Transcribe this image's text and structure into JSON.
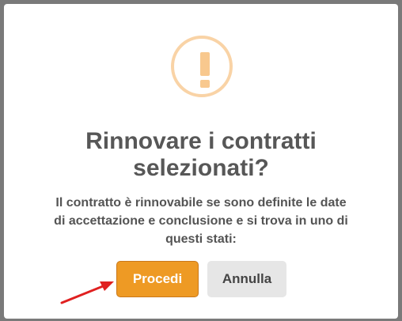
{
  "dialog": {
    "icon": "warning-exclamation-icon",
    "icon_glyph": "!",
    "title_line1": "Rinnovare i contratti",
    "title_line2": "selezionati?",
    "message_line1": "Il contratto è rinnovabile se sono definite le date",
    "message_line2": "di accettazione e conclusione e si trova in uno di",
    "message_line3": "questi stati:",
    "confirm_label": "Procedi",
    "cancel_label": "Annulla"
  },
  "colors": {
    "primary_button": "#ee9a24",
    "secondary_button": "#e6e6e6",
    "icon_accent": "#f8c88e",
    "annotation_arrow": "#e02020"
  },
  "annotation": {
    "type": "arrow",
    "points_to": "confirm-button"
  }
}
